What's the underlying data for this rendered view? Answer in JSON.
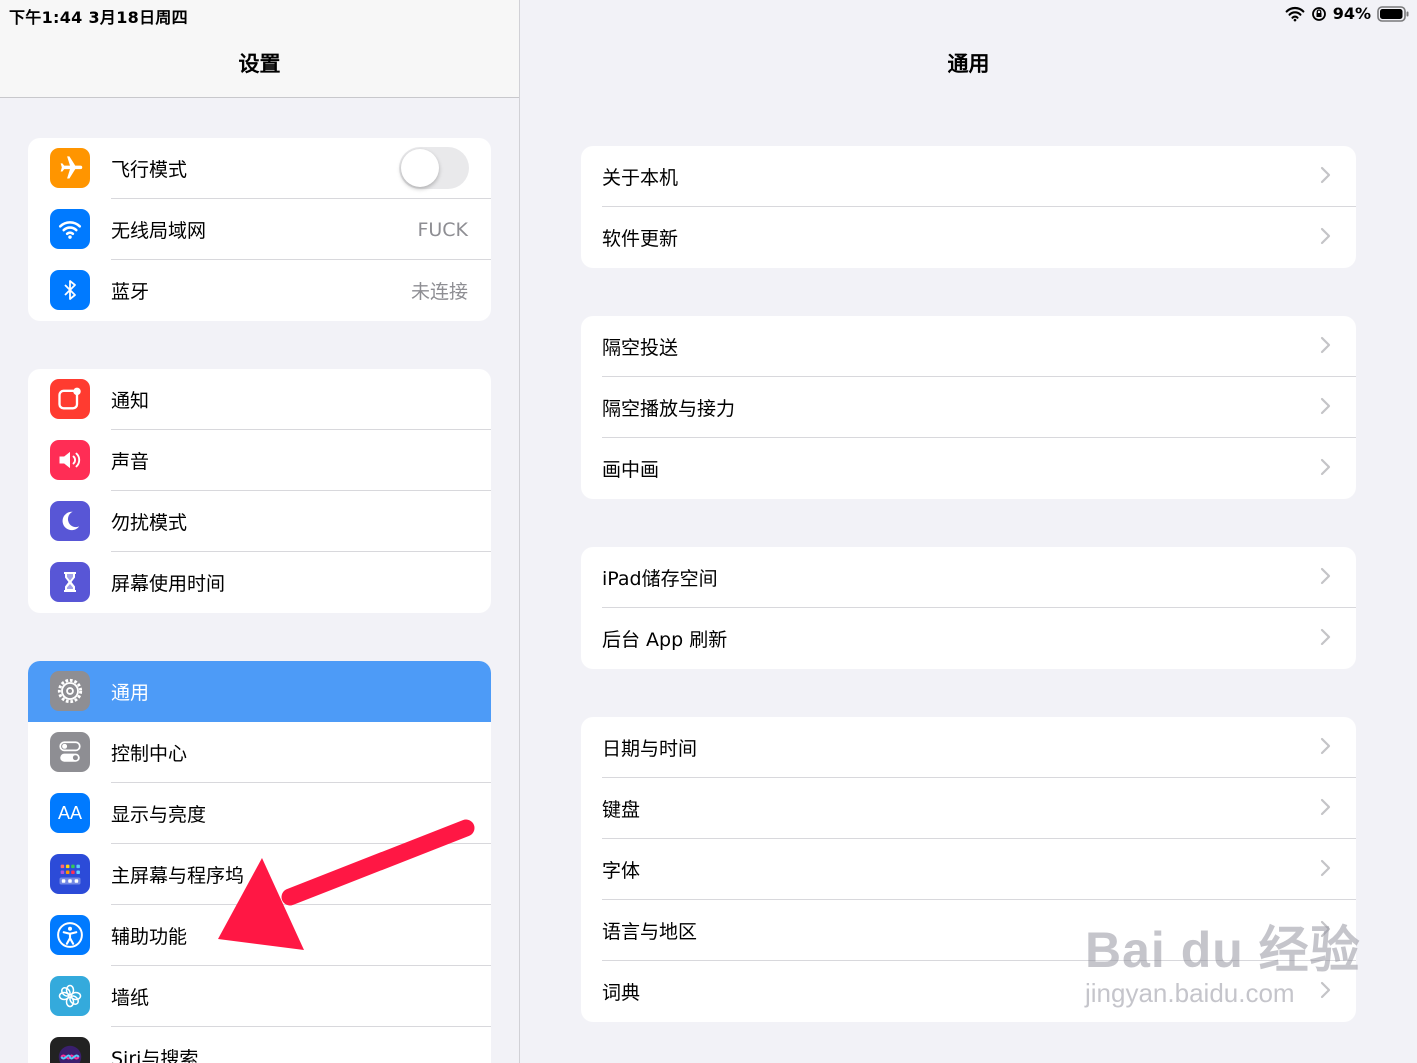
{
  "status_bar": {
    "time_date": "下午1:44   3月18日周四",
    "battery": "94%"
  },
  "sidebar": {
    "title": "设置",
    "group1": [
      {
        "label": "飞行模式",
        "icon": "airplane-icon",
        "color": "#ff9500"
      },
      {
        "label": "无线局域网",
        "value": "FUCK",
        "icon": "wifi-icon",
        "color": "#007aff"
      },
      {
        "label": "蓝牙",
        "value": "未连接",
        "icon": "bluetooth-icon",
        "color": "#007aff"
      }
    ],
    "group2": [
      {
        "label": "通知",
        "icon": "notifications-icon",
        "color": "#ff3b30"
      },
      {
        "label": "声音",
        "icon": "sound-icon",
        "color": "#ff2d55"
      },
      {
        "label": "勿扰模式",
        "icon": "moon-icon",
        "color": "#5856d6"
      },
      {
        "label": "屏幕使用时间",
        "icon": "hourglass-icon",
        "color": "#5856d6"
      }
    ],
    "group3": [
      {
        "label": "通用",
        "icon": "gear-icon",
        "color": "#8e8e93"
      },
      {
        "label": "控制中心",
        "icon": "control-center-icon",
        "color": "#8e8e93"
      },
      {
        "label": "显示与亮度",
        "icon": "display-icon",
        "color": "#007aff",
        "glyph": "AA"
      },
      {
        "label": "主屏幕与程序坞",
        "icon": "home-screen-icon",
        "color": "#2c4bd8"
      },
      {
        "label": "辅助功能",
        "icon": "accessibility-icon",
        "color": "#007aff"
      },
      {
        "label": "墙纸",
        "icon": "wallpaper-icon",
        "color": "#34aadc"
      },
      {
        "label": "Siri与搜索",
        "icon": "siri-icon",
        "color": "#222222"
      }
    ]
  },
  "main": {
    "title": "通用",
    "group1": [
      "关于本机",
      "软件更新"
    ],
    "group2": [
      "隔空投送",
      "隔空播放与接力",
      "画中画"
    ],
    "group3": [
      "iPad储存空间",
      "后台 App 刷新"
    ],
    "group4": [
      "日期与时间",
      "键盘",
      "字体",
      "语言与地区",
      "词典"
    ]
  },
  "watermark": {
    "brand": "Bai du 经验",
    "url": "jingyan.baidu.com"
  },
  "colors": {
    "selected": "#4d9bf7",
    "arrow": "#ff1744",
    "background": "#f2f2f7"
  }
}
